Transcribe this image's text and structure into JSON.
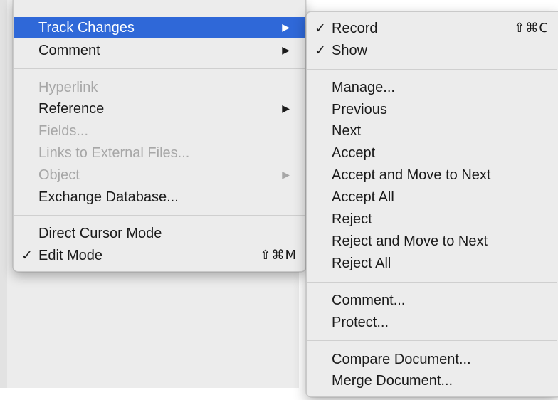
{
  "main_menu": {
    "items": [
      {
        "label": "Track Changes",
        "state": "highlighted",
        "submenu": true
      },
      {
        "label": "Comment",
        "submenu": true
      },
      {
        "label": "Hyperlink",
        "state": "disabled"
      },
      {
        "label": "Reference",
        "submenu": true
      },
      {
        "label": "Fields...",
        "state": "disabled"
      },
      {
        "label": "Links to External Files...",
        "state": "disabled"
      },
      {
        "label": "Object",
        "state": "disabled",
        "submenu": true
      },
      {
        "label": "Exchange Database..."
      },
      {
        "label": "Direct Cursor Mode"
      },
      {
        "label": "Edit Mode",
        "checked": true,
        "shortcut": "⇧⌘M"
      }
    ]
  },
  "track_changes_submenu": {
    "items": [
      {
        "label": "Record",
        "checked": true,
        "shortcut": "⇧⌘C"
      },
      {
        "label": "Show",
        "checked": true
      },
      {
        "label": "Manage..."
      },
      {
        "label": "Previous"
      },
      {
        "label": "Next"
      },
      {
        "label": "Accept"
      },
      {
        "label": "Accept and Move to Next"
      },
      {
        "label": "Accept All"
      },
      {
        "label": "Reject"
      },
      {
        "label": "Reject and Move to Next"
      },
      {
        "label": "Reject All"
      },
      {
        "label": "Comment..."
      },
      {
        "label": "Protect..."
      },
      {
        "label": "Compare Document..."
      },
      {
        "label": "Merge Document..."
      }
    ]
  },
  "glyphs": {
    "check": "✓",
    "submenu_arrow": "▶"
  },
  "colors": {
    "highlight": "#2f68d8",
    "disabled_text": "#a7a7a7",
    "menu_background": "#ececec"
  }
}
